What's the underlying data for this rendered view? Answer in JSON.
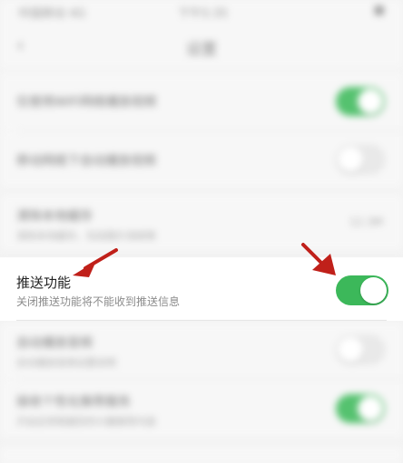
{
  "status_bar": {
    "carrier": "中国移动 4G",
    "time": "下午5:35",
    "battery": "■"
  },
  "nav": {
    "back_icon": "‹",
    "title": "设置"
  },
  "settings": {
    "rows": [
      {
        "label": "仅使用WiFi网络播放视频",
        "sub": "",
        "value": "",
        "toggle": "on"
      },
      {
        "label": "移动网络下自动播放视频",
        "sub": "",
        "value": "",
        "toggle": "off"
      },
      {
        "label": "清除本地缓存",
        "sub": "清除本地缓存，包括图片视频等",
        "value": "12.3M",
        "toggle": "none"
      },
      {
        "label": "推送功能",
        "sub": "关闭推送功能将不能收到推送信息",
        "value": "",
        "toggle": "on"
      },
      {
        "label": "自动播放音频",
        "sub": "自动播放音频设置说明",
        "value": "",
        "toggle": "off"
      },
      {
        "label": "接收个性化推荐服务",
        "sub": "开启后将根据您的兴趣推荐内容",
        "value": "",
        "toggle": "on"
      }
    ]
  },
  "colors": {
    "toggle_on": "#3cb85a",
    "annotation_arrow": "#c0201a"
  }
}
